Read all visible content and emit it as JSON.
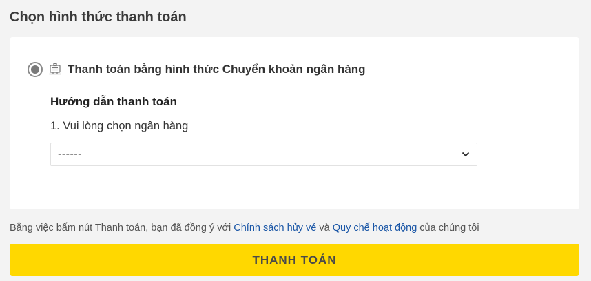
{
  "section": {
    "title": "Chọn hình thức thanh toán"
  },
  "payment_option": {
    "label": "Thanh toán bằng hình thức Chuyển khoản ngân hàng",
    "selected": true,
    "icon": "bank-transfer-icon"
  },
  "guide": {
    "title": "Hướng dẫn thanh toán",
    "step1": "1. Vui lòng chọn ngân hàng"
  },
  "bank_select": {
    "value": "------"
  },
  "terms": {
    "prefix": "Bằng việc bấm nút Thanh toán, bạn đã đồng ý với ",
    "link1": "Chính sách hủy vé",
    "middle": " và ",
    "link2": "Quy chế hoạt động",
    "suffix": " của chúng tôi"
  },
  "pay_button": {
    "label": "THANH TOÁN"
  },
  "colors": {
    "background": "#f3f3f3",
    "card": "#ffffff",
    "accent_button": "#ffd800",
    "link": "#1a56a6"
  }
}
